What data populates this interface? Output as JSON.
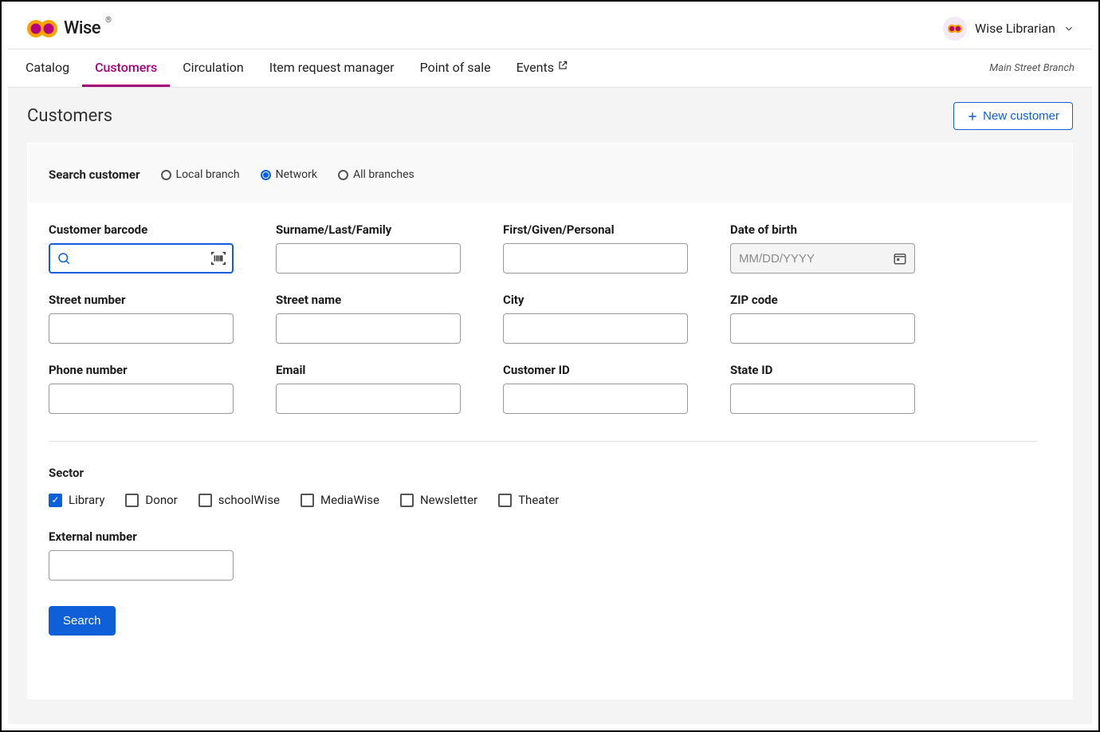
{
  "header": {
    "brand": "Wise",
    "user_name": "Wise Librarian"
  },
  "nav": {
    "items": [
      {
        "label": "Catalog",
        "active": false,
        "external": false
      },
      {
        "label": "Customers",
        "active": true,
        "external": false
      },
      {
        "label": "Circulation",
        "active": false,
        "external": false
      },
      {
        "label": "Item request manager",
        "active": false,
        "external": false
      },
      {
        "label": "Point of sale",
        "active": false,
        "external": false
      },
      {
        "label": "Events",
        "active": false,
        "external": true
      }
    ],
    "branch_label": "Main Street Branch"
  },
  "page": {
    "title": "Customers",
    "new_button": "New customer"
  },
  "search": {
    "heading": "Search customer",
    "scope_options": [
      {
        "label": "Local branch",
        "selected": false
      },
      {
        "label": "Network",
        "selected": true
      },
      {
        "label": "All branches",
        "selected": false
      }
    ],
    "fields": {
      "barcode_label": "Customer barcode",
      "surname_label": "Surname/Last/Family",
      "first_label": "First/Given/Personal",
      "dob_label": "Date of birth",
      "dob_placeholder": "MM/DD/YYYY",
      "streetnum_label": "Street number",
      "streetname_label": "Street name",
      "city_label": "City",
      "zip_label": "ZIP code",
      "phone_label": "Phone number",
      "email_label": "Email",
      "customerid_label": "Customer ID",
      "stateid_label": "State ID"
    },
    "sector_label": "Sector",
    "sectors": [
      {
        "label": "Library",
        "checked": true
      },
      {
        "label": "Donor",
        "checked": false
      },
      {
        "label": "schoolWise",
        "checked": false
      },
      {
        "label": "MediaWise",
        "checked": false
      },
      {
        "label": "Newsletter",
        "checked": false
      },
      {
        "label": "Theater",
        "checked": false
      }
    ],
    "external_label": "External number",
    "search_button": "Search"
  }
}
